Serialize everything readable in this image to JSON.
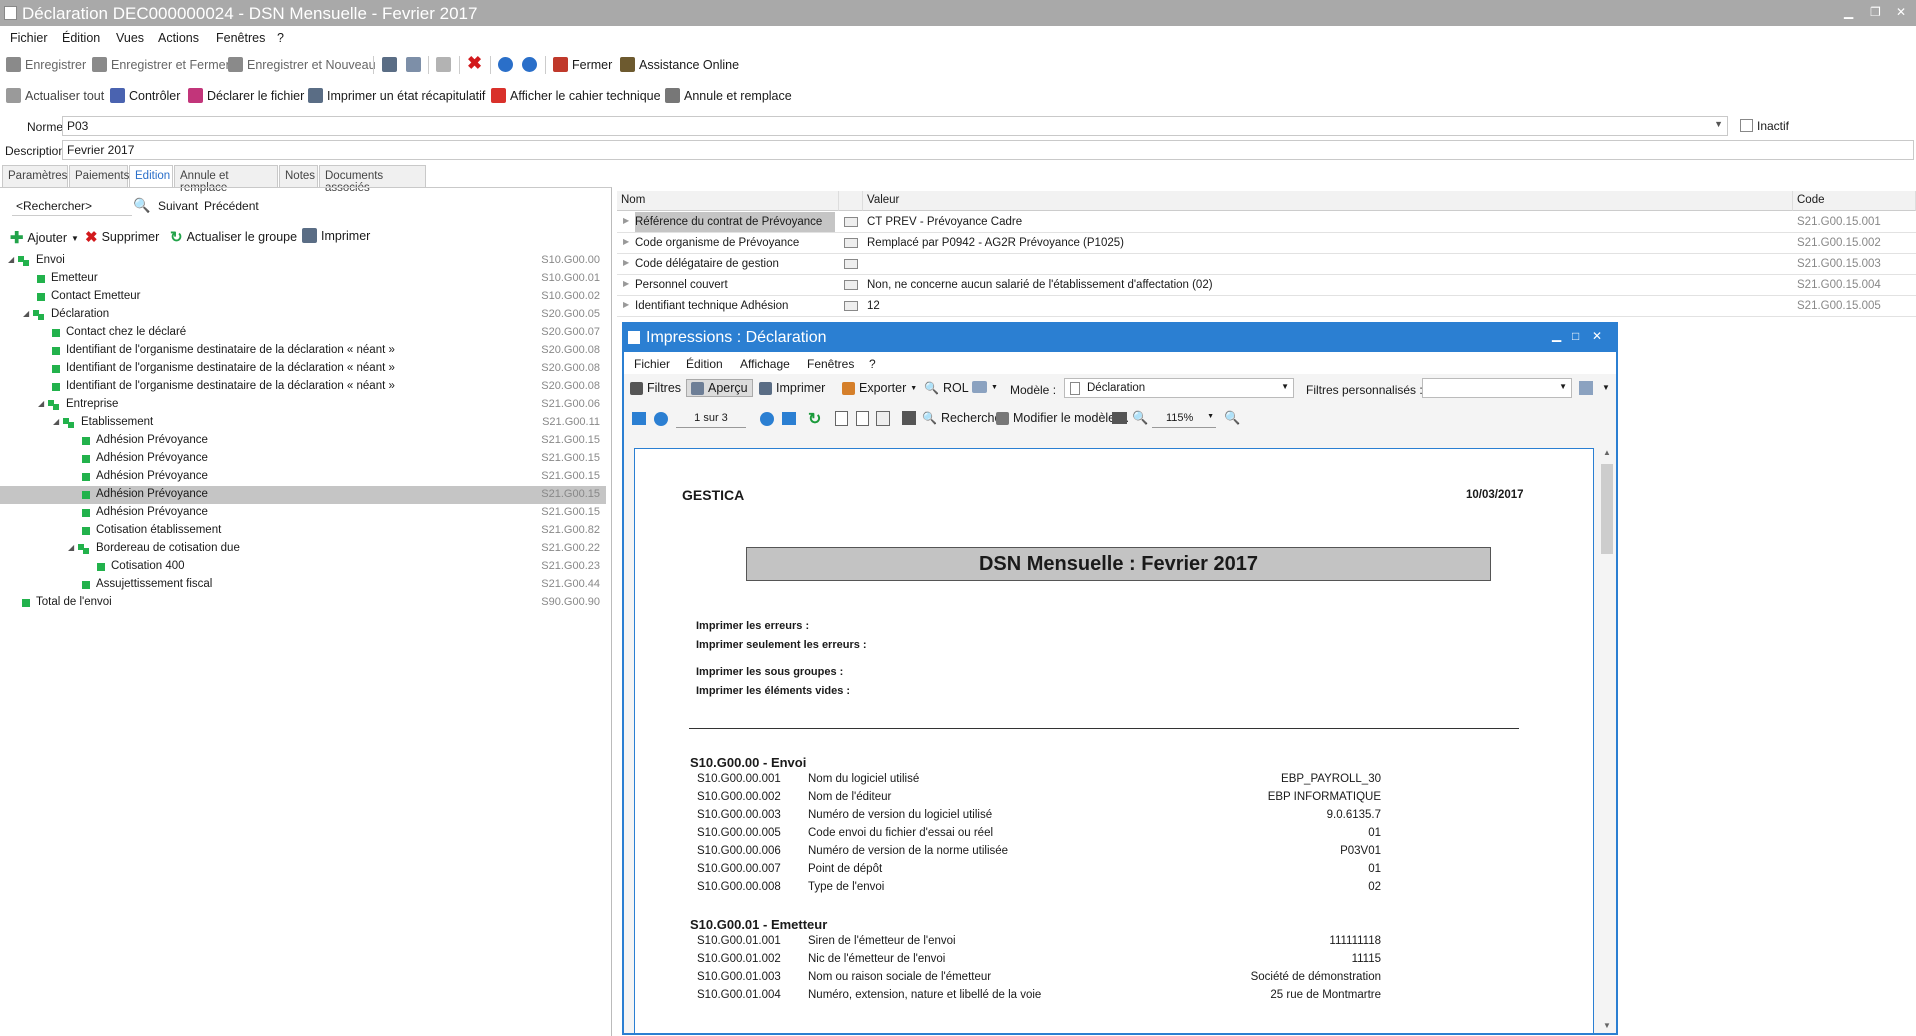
{
  "window": {
    "title": "Déclaration DEC000000024  - DSN Mensuelle - Fevrier 2017"
  },
  "menu": [
    "Fichier",
    "Édition",
    "Vues",
    "Actions",
    "Fenêtres",
    "?"
  ],
  "toolbar1": {
    "save": "Enregistrer",
    "save_close": "Enregistrer et Fermer",
    "save_new": "Enregistrer et Nouveau",
    "close": "Fermer",
    "assist": "Assistance Online"
  },
  "toolbar2": {
    "refresh_all": "Actualiser tout",
    "check": "Contrôler",
    "declare": "Déclarer le fichier",
    "print_summary": "Imprimer un état récapitulatif",
    "show_spec": "Afficher le cahier technique",
    "cancel_replace": "Annule et remplace"
  },
  "form": {
    "norme_label": "Norme",
    "norme_value": "P03",
    "inactif_label": "Inactif",
    "description_label": "Description",
    "description_value": "Fevrier 2017"
  },
  "tabs": [
    "Paramètres",
    "Paiements",
    "Edition",
    "Annule et remplace",
    "Notes",
    "Documents associés"
  ],
  "left": {
    "search_placeholder": "<Rechercher>",
    "next": "Suivant",
    "prev": "Précédent",
    "add": "Ajouter",
    "delete": "Supprimer",
    "refresh_group": "Actualiser le groupe",
    "print": "Imprimer"
  },
  "tree": [
    {
      "label": "Envoi",
      "code": "S10.G00.00",
      "level": 0,
      "group": true
    },
    {
      "label": "Emetteur",
      "code": "S10.G00.01",
      "level": 1
    },
    {
      "label": "Contact Emetteur",
      "code": "S10.G00.02",
      "level": 1
    },
    {
      "label": "Déclaration",
      "code": "S20.G00.05",
      "level": 1,
      "group": true
    },
    {
      "label": "Contact chez le déclaré",
      "code": "S20.G00.07",
      "level": 2
    },
    {
      "label": "Identifiant de l'organisme destinataire de la déclaration « néant »",
      "code": "S20.G00.08",
      "level": 2
    },
    {
      "label": "Identifiant de l'organisme destinataire de la déclaration « néant »",
      "code": "S20.G00.08",
      "level": 2
    },
    {
      "label": "Identifiant de l'organisme destinataire de la déclaration « néant »",
      "code": "S20.G00.08",
      "level": 2
    },
    {
      "label": "Entreprise",
      "code": "S21.G00.06",
      "level": 2,
      "group": true
    },
    {
      "label": "Etablissement",
      "code": "S21.G00.11",
      "level": 3,
      "group": true
    },
    {
      "label": "Adhésion Prévoyance",
      "code": "S21.G00.15",
      "level": 4
    },
    {
      "label": "Adhésion Prévoyance",
      "code": "S21.G00.15",
      "level": 4
    },
    {
      "label": "Adhésion Prévoyance",
      "code": "S21.G00.15",
      "level": 4
    },
    {
      "label": "Adhésion Prévoyance",
      "code": "S21.G00.15",
      "level": 4,
      "selected": true
    },
    {
      "label": "Adhésion Prévoyance",
      "code": "S21.G00.15",
      "level": 4
    },
    {
      "label": "Cotisation établissement",
      "code": "S21.G00.82",
      "level": 4
    },
    {
      "label": "Bordereau de cotisation due",
      "code": "S21.G00.22",
      "level": 4,
      "group": true
    },
    {
      "label": "Cotisation 400",
      "code": "S21.G00.23",
      "level": 5
    },
    {
      "label": "Assujettissement fiscal",
      "code": "S21.G00.44",
      "level": 4
    },
    {
      "label": "Total de l'envoi",
      "code": "S90.G00.90",
      "level": 0
    }
  ],
  "grid": {
    "headers": [
      "Nom",
      "Valeur",
      "Code"
    ],
    "rows": [
      {
        "name": "Référence du contrat de Prévoyance",
        "value": "CT PREV - Prévoyance Cadre",
        "code": "S21.G00.15.001",
        "selected": true
      },
      {
        "name": "Code organisme de Prévoyance",
        "value": "Remplacé par P0942 - AG2R Prévoyance (P1025)",
        "code": "S21.G00.15.002"
      },
      {
        "name": "Code délégataire de gestion",
        "value": "",
        "code": "S21.G00.15.003"
      },
      {
        "name": "Personnel couvert",
        "value": "Non, ne concerne aucun salarié de l'établissement d'affectation (02)",
        "code": "S21.G00.15.004"
      },
      {
        "name": "Identifiant technique Adhésion",
        "value": "12",
        "code": "S21.G00.15.005"
      }
    ]
  },
  "popup": {
    "title": "Impressions : Déclaration",
    "menu": [
      "Fichier",
      "Édition",
      "Affichage",
      "Fenêtres",
      "?"
    ],
    "filters": "Filtres",
    "preview": "Aperçu",
    "print": "Imprimer",
    "export": "Exporter",
    "rol": "ROL",
    "model_label": "Modèle :",
    "model_value": "Déclaration",
    "custom_filters": "Filtres personnalisés :",
    "page": "1 sur 3",
    "search": "Rechercher",
    "edit_model": "Modifier le modèle ...",
    "zoom": "115%"
  },
  "report": {
    "company": "GESTICA",
    "date": "10/03/2017",
    "title": "DSN Mensuelle : Fevrier 2017",
    "options": [
      "Imprimer les erreurs :",
      "Imprimer seulement les erreurs :",
      "Imprimer les sous groupes :",
      "Imprimer les éléments vides :"
    ],
    "sections": [
      {
        "heading": "S10.G00.00 - Envoi",
        "rows": [
          {
            "code": "S10.G00.00.001",
            "label": "Nom du logiciel utilisé",
            "value": "EBP_PAYROLL_30"
          },
          {
            "code": "S10.G00.00.002",
            "label": "Nom de l'éditeur",
            "value": "EBP INFORMATIQUE"
          },
          {
            "code": "S10.G00.00.003",
            "label": "Numéro de version du logiciel utilisé",
            "value": "9.0.6135.7"
          },
          {
            "code": "S10.G00.00.005",
            "label": "Code envoi du fichier d'essai ou réel",
            "value": "01"
          },
          {
            "code": "S10.G00.00.006",
            "label": "Numéro de version de la norme utilisée",
            "value": "P03V01"
          },
          {
            "code": "S10.G00.00.007",
            "label": "Point de dépôt",
            "value": "01"
          },
          {
            "code": "S10.G00.00.008",
            "label": "Type de l'envoi",
            "value": "02"
          }
        ]
      },
      {
        "heading": "S10.G00.01 - Emetteur",
        "rows": [
          {
            "code": "S10.G00.01.001",
            "label": "Siren de l'émetteur de l'envoi",
            "value": "111111118"
          },
          {
            "code": "S10.G00.01.002",
            "label": "Nic de l'émetteur de l'envoi",
            "value": "11115"
          },
          {
            "code": "S10.G00.01.003",
            "label": "Nom ou raison sociale de l'émetteur",
            "value": "Société de démonstration"
          },
          {
            "code": "S10.G00.01.004",
            "label": "Numéro, extension, nature et libellé de la voie",
            "value": "25 rue de Montmartre"
          }
        ]
      }
    ]
  }
}
